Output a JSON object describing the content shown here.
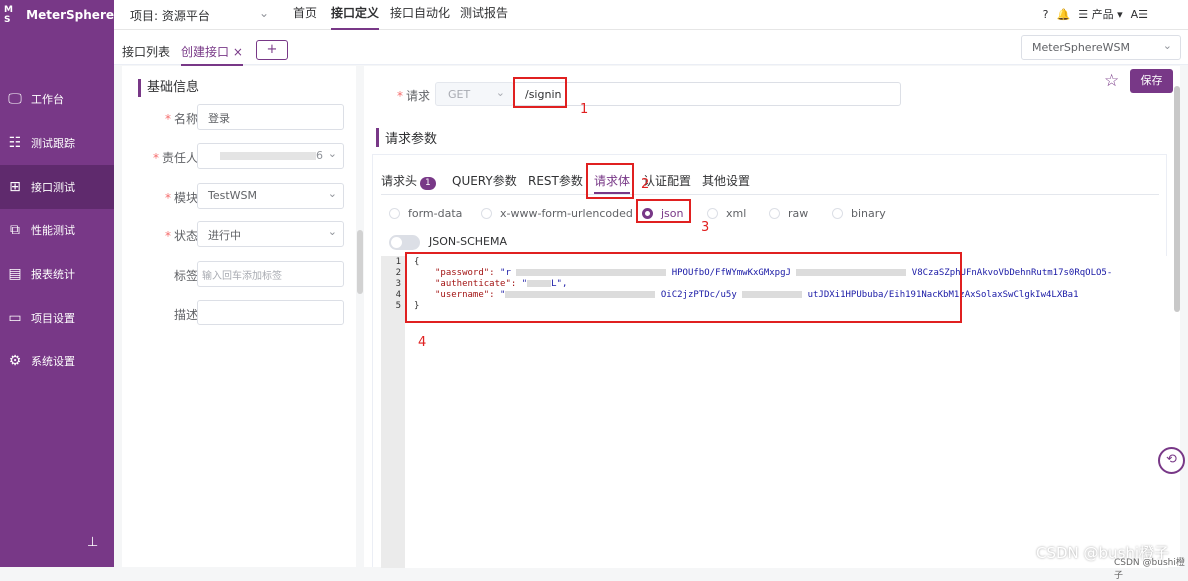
{
  "app": {
    "name": "MeterSphere",
    "logo_mark": "M S"
  },
  "sidebar": {
    "items": [
      {
        "label": "工作台",
        "icon": "monitor-icon",
        "glyph": "🖵"
      },
      {
        "label": "测试跟踪",
        "icon": "clipboard-icon",
        "glyph": "☷"
      },
      {
        "label": "接口测试",
        "icon": "api-icon",
        "glyph": "⊞"
      },
      {
        "label": "性能测试",
        "icon": "chart-icon",
        "glyph": "⧉"
      },
      {
        "label": "报表统计",
        "icon": "report-icon",
        "glyph": "▤"
      },
      {
        "label": "项目设置",
        "icon": "folder-icon",
        "glyph": "▭"
      },
      {
        "label": "系统设置",
        "icon": "gears-icon",
        "glyph": "⚙"
      }
    ],
    "pin_glyph": "⊥"
  },
  "header": {
    "project": "项目: 资源平台",
    "arrow": "⌄",
    "menus": [
      "首页",
      "接口定义",
      "接口自动化",
      "测试报告"
    ],
    "tools": {
      "help": "?",
      "bell": "🔔",
      "product": "☰ 产品 ▾",
      "lang": "A☰"
    }
  },
  "tabs": {
    "items": [
      "接口列表",
      "创建接口"
    ],
    "close": "×",
    "add": "+",
    "env": "MeterSphereWSM",
    "env_arrow": "⌄"
  },
  "basic": {
    "title": "基础信息",
    "fields": [
      {
        "label": "名称",
        "required": "*",
        "value": "登录"
      },
      {
        "label": "责任人",
        "required": "*",
        "value": "6"
      },
      {
        "label": "模块",
        "required": "*",
        "value": "TestWSM"
      },
      {
        "label": "状态",
        "required": "*",
        "value": "进行中"
      },
      {
        "label": "标签",
        "required": "",
        "placeholder": "输入回车添加标签"
      },
      {
        "label": "描述",
        "required": "",
        "value": ""
      }
    ]
  },
  "request": {
    "label": "请求",
    "required": "*",
    "method": "GET",
    "url": "/signin",
    "save": "保存",
    "star": "☆"
  },
  "params": {
    "title": "请求参数",
    "tabs": [
      "请求头",
      "QUERY参数",
      "REST参数",
      "请求体",
      "认证配置",
      "其他设置"
    ],
    "header_count": "1",
    "body_types": [
      "form-data",
      "x-www-form-urlencoded",
      "json",
      "xml",
      "raw",
      "binary"
    ],
    "selected_body": "json",
    "schema_label": "JSON-SCHEMA"
  },
  "editor": {
    "lines": [
      "1",
      "2",
      "3",
      "4",
      "5"
    ],
    "code": {
      "open": "{",
      "password_key": "\"password\": ",
      "password_val_a": "\"r",
      "password_val_b": "HPOUfbO/FfWYmwKxGMxpgJ",
      "password_val_c": "V8CzaSZphUFnAkvoVbDehnRutm17s0RqOLO5-",
      "authenticate_key": "\"authenticate\": ",
      "authenticate_val_a": "\"",
      "authenticate_val_b": "L\",",
      "username_key": "\"username\": ",
      "username_val_a": "\"",
      "username_val_b": "OiC2jzPTDc/u5y",
      "username_val_c": "utJDXi1HPUbuba/Eih191NacKbM1zAxSolaxSwClgkIw4LXBa1",
      "close": "}"
    }
  },
  "annotations": [
    "1",
    "2",
    "3",
    "4"
  ],
  "float_icon": "⟲",
  "watermark": {
    "main": "CSDN @bushi橙子",
    "sub": "CSDN @bushi橙子"
  }
}
